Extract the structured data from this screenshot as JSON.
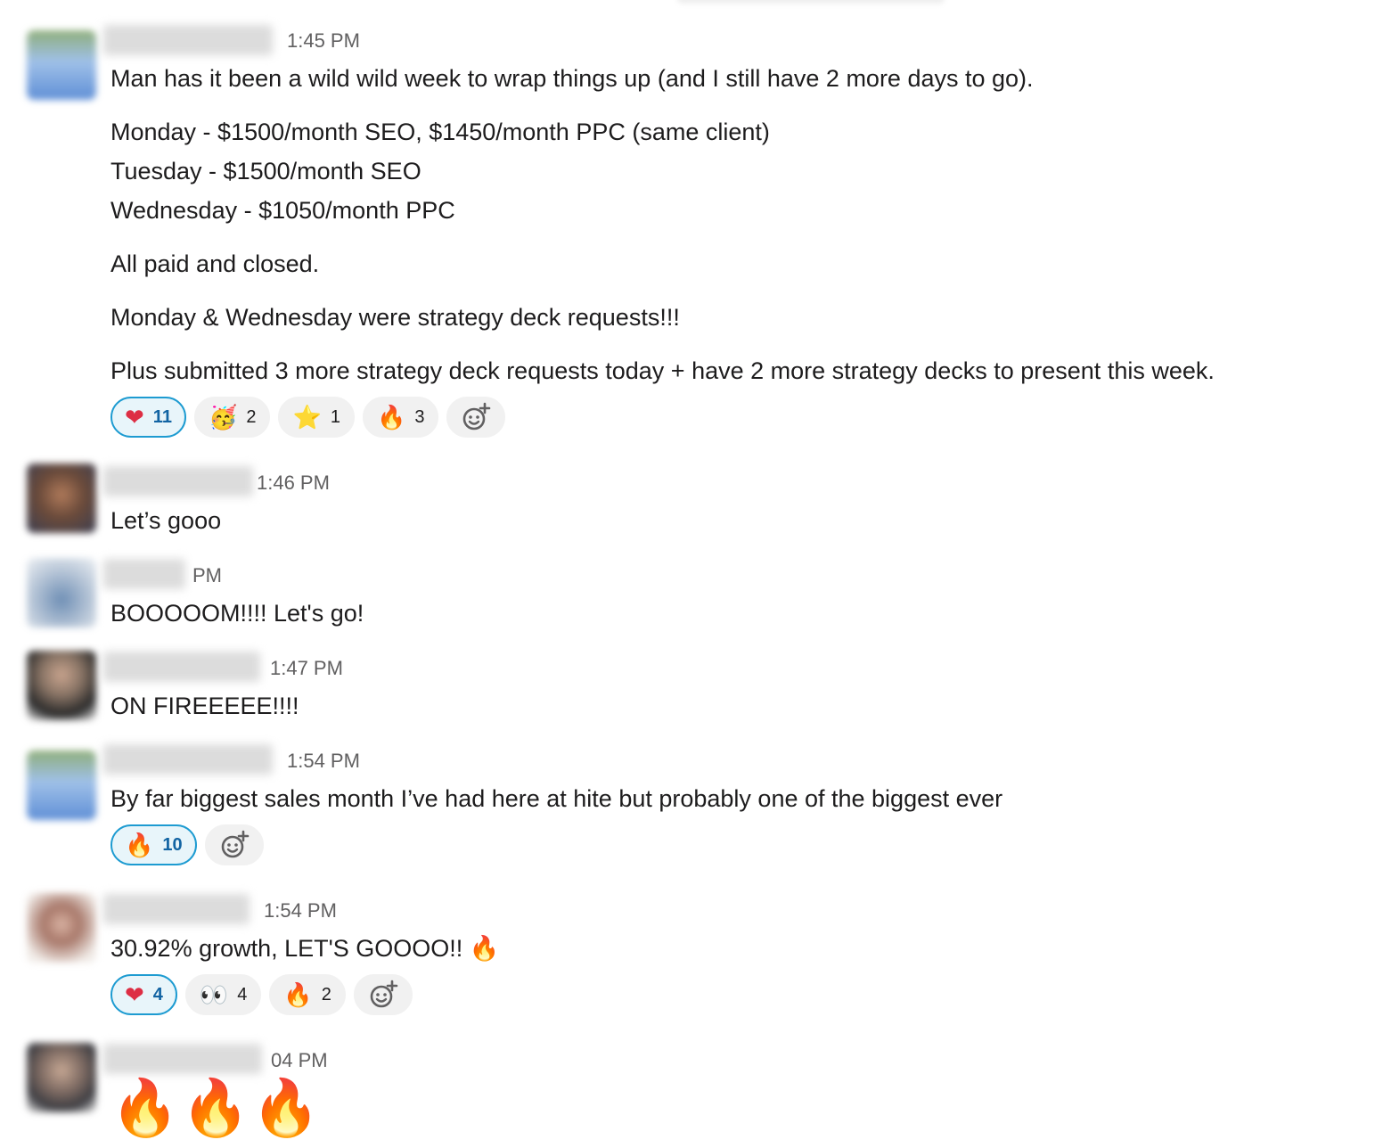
{
  "messages": [
    {
      "time": "1:45 PM",
      "lines": [
        "Man has it been a wild wild week to wrap things up (and I still have 2 more days to go).",
        "Monday - $1500/month SEO, $1450/month PPC (same client)",
        "Tuesday - $1500/month SEO",
        "Wednesday - $1050/month PPC",
        "All paid and closed.",
        "Monday & Wednesday were strategy deck requests!!!",
        "Plus submitted 3 more strategy deck requests today + have 2 more strategy decks to present this week."
      ],
      "reactions": [
        {
          "emoji": "❤",
          "count": "11",
          "mine": true
        },
        {
          "emoji": "🥳",
          "count": "2",
          "mine": false
        },
        {
          "emoji": "⭐",
          "count": "1",
          "mine": false
        },
        {
          "emoji": "🔥",
          "count": "3",
          "mine": false
        }
      ]
    },
    {
      "time": "1:46 PM",
      "text": "Let’s gooo"
    },
    {
      "time": "PM",
      "text": "BOOOOOM!!!! Let's go!"
    },
    {
      "time": "1:47 PM",
      "text": "ON FIREEEEE!!!!"
    },
    {
      "time": "1:54 PM",
      "text": "By far biggest sales month I’ve had here at hite but probably one of the biggest ever",
      "reactions": [
        {
          "emoji": "🔥",
          "count": "10",
          "mine": true
        }
      ]
    },
    {
      "time": "1:54 PM",
      "text": "30.92% growth, LET'S GOOOO!! 🔥",
      "reactions": [
        {
          "emoji": "❤",
          "count": "4",
          "mine": true
        },
        {
          "emoji": "👀",
          "count": "4",
          "mine": false
        },
        {
          "emoji": "🔥",
          "count": "2",
          "mine": false
        }
      ]
    },
    {
      "time": "04 PM",
      "text": "🔥🔥🔥"
    }
  ],
  "add_reaction_icon": "add-reaction-icon",
  "colors": {
    "accent": "#1d9bd1",
    "mine_bg": "#e8f5fa",
    "mine_text": "#1264a3",
    "reaction_bg": "#f1f1f1",
    "timestamp": "#616061"
  }
}
